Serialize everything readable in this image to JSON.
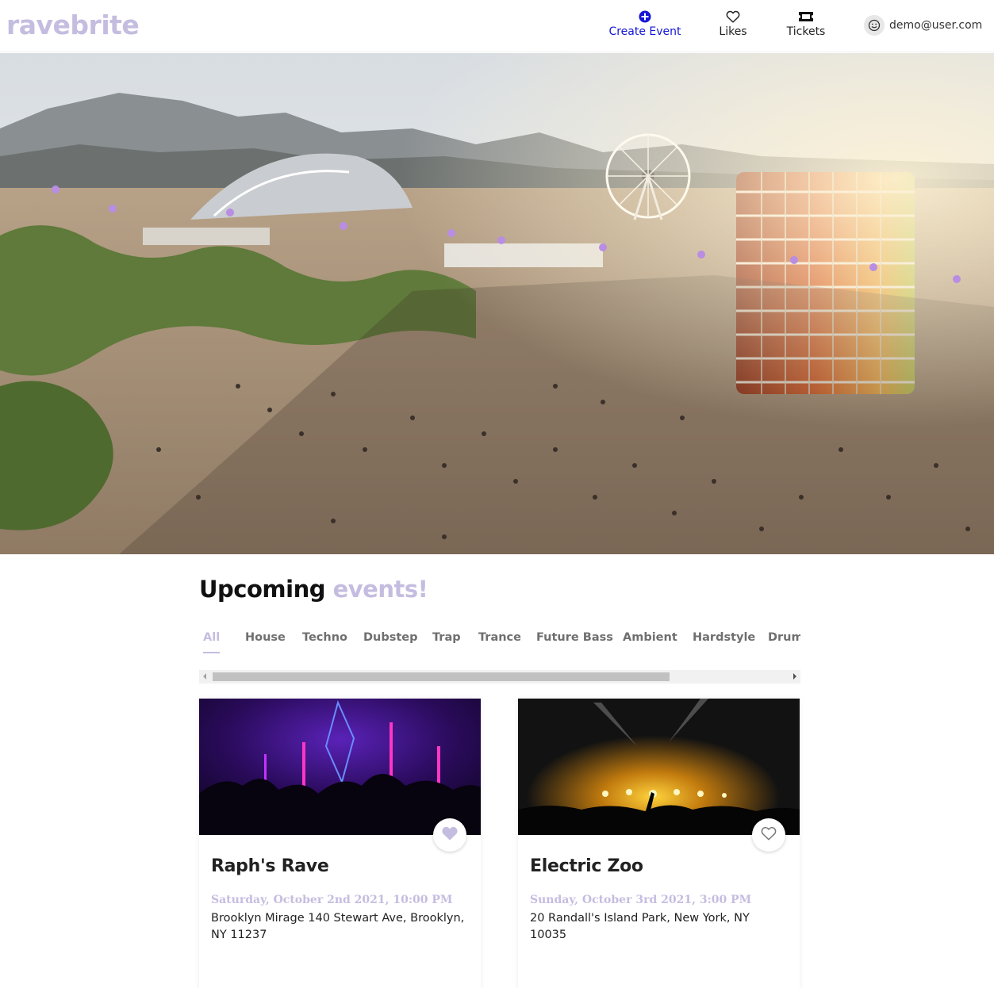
{
  "header": {
    "logo": "ravebrite",
    "nav": {
      "create_event": "Create Event",
      "likes": "Likes",
      "tickets": "Tickets"
    },
    "user_email": "demo@user.com"
  },
  "hero": {
    "image": "festival crowd aerial photo"
  },
  "section": {
    "title_dark": "Upcoming",
    "title_light": "events!"
  },
  "genres": {
    "active": "All",
    "items": [
      "All",
      "House",
      "Techno",
      "Dubstep",
      "Trap",
      "Trance",
      "Future Bass",
      "Ambient",
      "Hardstyle",
      "Drum"
    ]
  },
  "scrollbar": {
    "thumb_fraction": 0.8
  },
  "events": [
    {
      "title": "Raph's Rave",
      "date": "Saturday, October 2nd 2021, 10:00 PM",
      "address": "Brooklyn Mirage 140 Stewart Ave, Brooklyn, NY 11237",
      "liked": true,
      "image": "club rave with purple lights"
    },
    {
      "title": "Electric Zoo",
      "date": "Sunday, October 3rd 2021, 3:00 PM",
      "address": "20 Randall's Island Park, New York, NY 10035",
      "liked": false,
      "image": "concert crowd with yellow stage lights"
    }
  ],
  "colors": {
    "brand": "#c5bde0",
    "link_blue": "#1515d6",
    "text": "#222222"
  },
  "icons": {
    "create": "plus-circle-icon",
    "likes": "heart-outline-icon",
    "tickets": "ticket-icon",
    "user": "smiley-icon"
  }
}
